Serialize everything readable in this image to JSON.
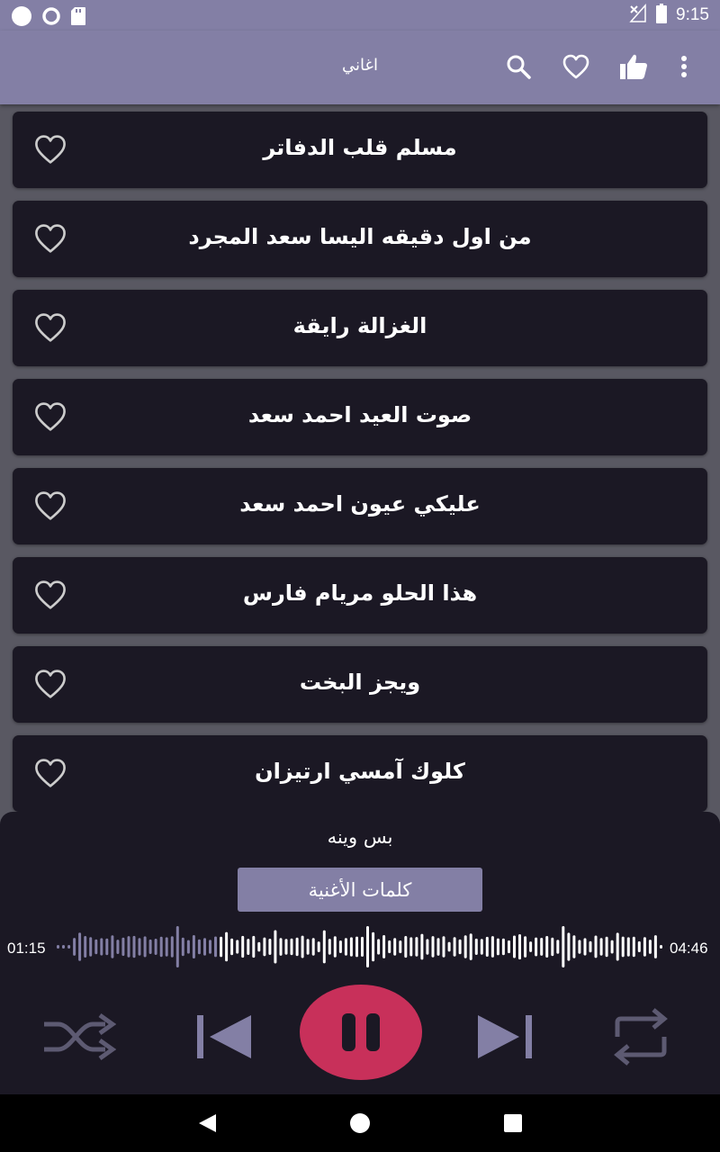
{
  "status_bar": {
    "time": "9:15"
  },
  "app_bar": {
    "title": "اغاني"
  },
  "songs": [
    {
      "title": "مسلم قلب الدفاتر"
    },
    {
      "title": "من اول دقيقه اليسا سعد المجرد"
    },
    {
      "title": "الغزالة رايقة"
    },
    {
      "title": "صوت العيد احمد سعد"
    },
    {
      "title": "عليكي عيون احمد سعد"
    },
    {
      "title": "هذا الحلو مريام فارس"
    },
    {
      "title": "ويجز البخت"
    },
    {
      "title": "كلوك آمسي ارتيزان"
    }
  ],
  "player": {
    "now_playing": "بس وينه",
    "lyrics_button": "كلمات الأغنية",
    "elapsed": "01:15",
    "duration": "04:46",
    "progress": 0.26,
    "state": "playing"
  },
  "colors": {
    "accent": "#837fa5",
    "card": "#1b1824",
    "background": "#595862",
    "pause_button": "#c8305a",
    "waveform_played": "#837fa5",
    "waveform_unplayed": "#ffffff"
  }
}
